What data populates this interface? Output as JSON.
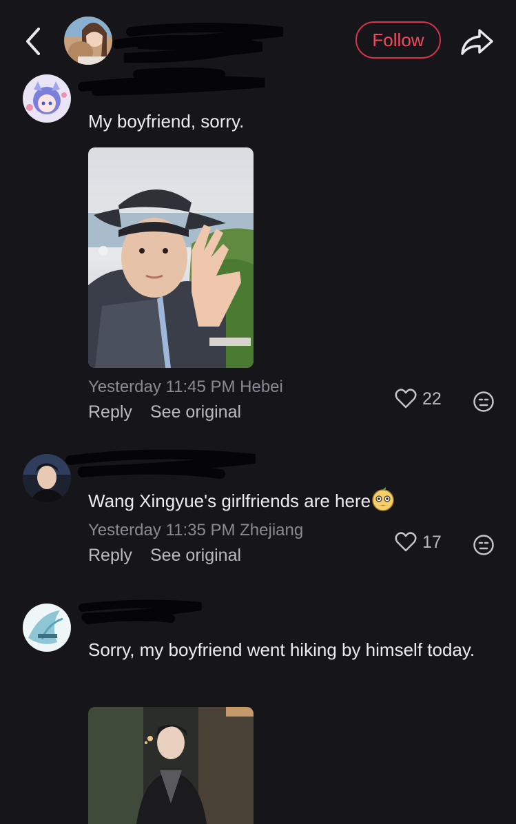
{
  "header": {
    "follow_label": "Follow",
    "icons": {
      "back": "chevron-left-icon",
      "share": "share-arrow-icon"
    },
    "accent": "#f04a5e"
  },
  "comments": [
    {
      "text": "My boyfriend, sorry.",
      "time": "Yesterday 11:45 PM",
      "location": "Hebei",
      "reply_label": "Reply",
      "original_label": "See original",
      "likes": "22"
    },
    {
      "text": "Wang Xingyue's girlfriends are here",
      "time": "Yesterday 11:35 PM",
      "location": "Zhejiang",
      "reply_label": "Reply",
      "original_label": "See original",
      "likes": "17"
    },
    {
      "text": "Sorry, my boyfriend went hiking by himself today."
    }
  ]
}
